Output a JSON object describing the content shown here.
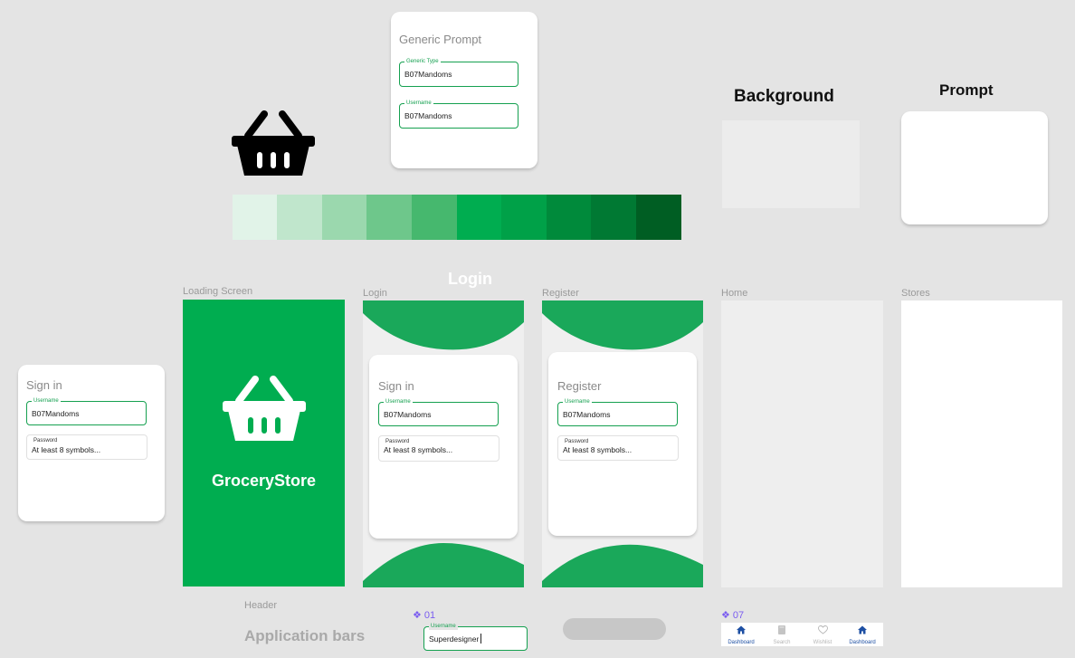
{
  "generic_prompt": {
    "title": "Generic Prompt",
    "field1": {
      "label": "Generic Type",
      "value": "B07Mandoms"
    },
    "field2": {
      "label": "Username",
      "value": "B07Mandoms"
    }
  },
  "palette": [
    "#e1f3e8",
    "#c0e6cc",
    "#9bd8ae",
    "#6ec78b",
    "#46b86e",
    "#00ad50",
    "#00a148",
    "#008a3b",
    "#007933",
    "#005e23"
  ],
  "headings": {
    "background": "Background",
    "prompt": "Prompt",
    "login": "Login"
  },
  "frames": {
    "loading": "Loading Screen",
    "login": "Login",
    "register": "Register",
    "home": "Home",
    "stores": "Stores",
    "header": "Header"
  },
  "loading": {
    "app_name": "GroceryStore"
  },
  "signin_standalone": {
    "title": "Sign in",
    "username_label": "Username",
    "username_value": "B07Mandoms",
    "password_label": "Password",
    "password_placeholder": "At least 8 symbols..."
  },
  "login_card": {
    "title": "Sign in",
    "username_label": "Username",
    "username_value": "B07Mandoms",
    "password_label": "Password",
    "password_placeholder": "At least 8 symbols..."
  },
  "register_card": {
    "title": "Register",
    "username_label": "Username",
    "username_value": "B07Mandoms",
    "password_label": "Password",
    "password_placeholder": "At least 8 symbols..."
  },
  "application_bars": {
    "title": "Application bars",
    "component_01": "❖ 01",
    "component_07": "❖ 07",
    "input_label": "Username",
    "input_value": "Superdesigner"
  },
  "bottom_nav": [
    {
      "label": "Dashboard",
      "icon": "home-icon",
      "color": "#1d4fa3"
    },
    {
      "label": "Search",
      "icon": "book-icon",
      "color": "#b5b5b5"
    },
    {
      "label": "Wishlist",
      "icon": "heart-icon",
      "color": "#b5b5b5"
    },
    {
      "label": "Dashboard",
      "icon": "home-icon",
      "color": "#1d4fa3"
    }
  ],
  "colors": {
    "brand_green": "#00ad50",
    "wave_green": "#1aa85a",
    "accent_purple": "#7a5cf0",
    "nav_blue": "#1d4fa3"
  }
}
